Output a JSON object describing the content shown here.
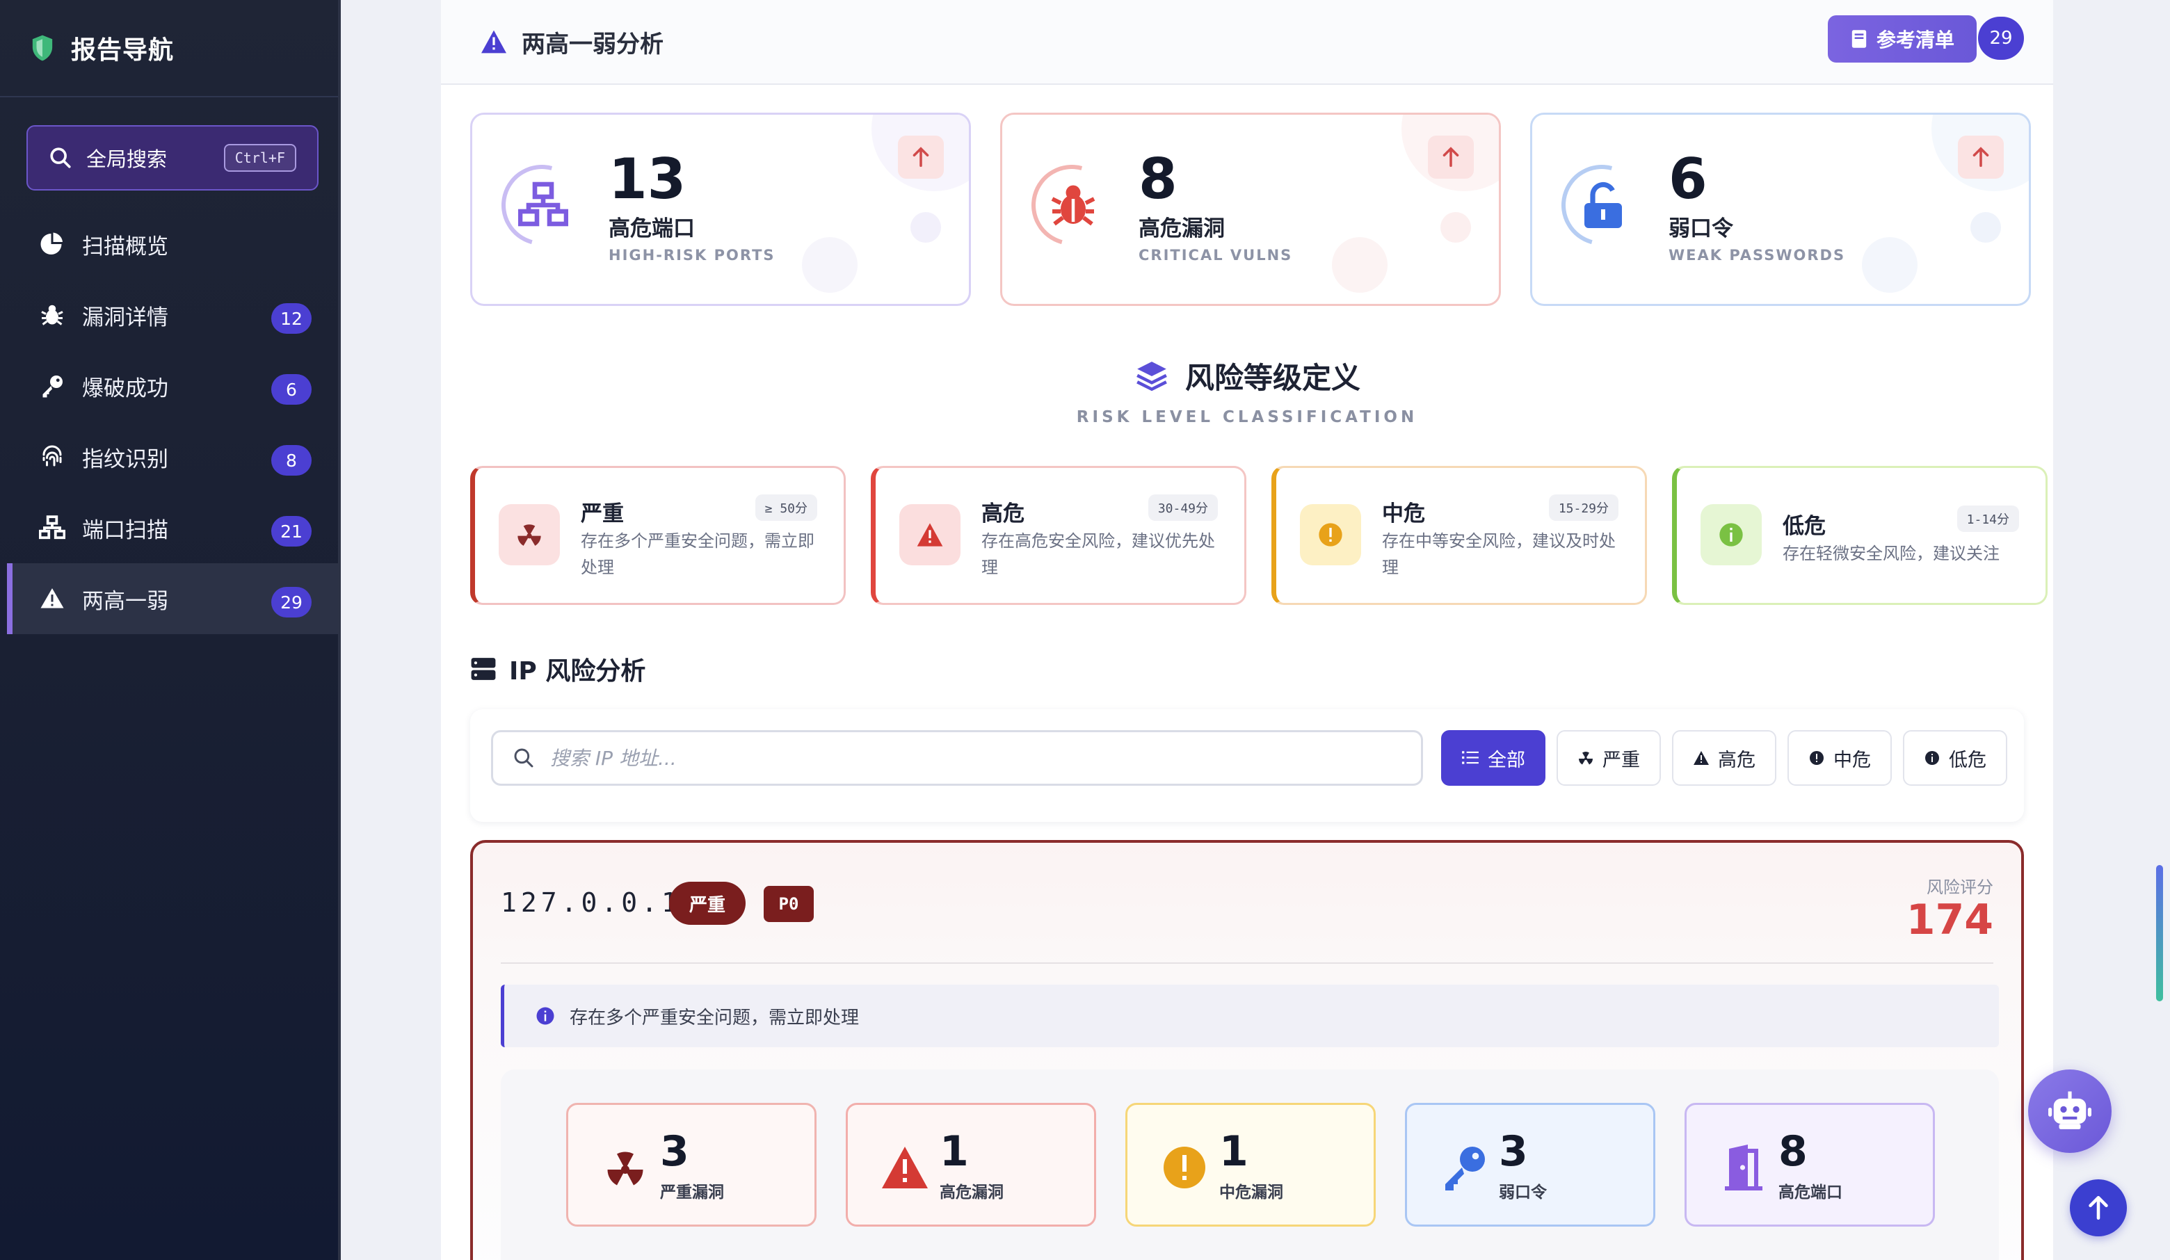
{
  "sidebar": {
    "title": "报告导航",
    "search": {
      "label": "全局搜索",
      "shortcut": "Ctrl+F"
    },
    "items": [
      {
        "label": "扫描概览",
        "icon": "pie-chart-icon",
        "badge": null
      },
      {
        "label": "漏洞详情",
        "icon": "bug-icon",
        "badge": "12"
      },
      {
        "label": "爆破成功",
        "icon": "key-icon",
        "badge": "6"
      },
      {
        "label": "指纹识别",
        "icon": "fingerprint-icon",
        "badge": "8"
      },
      {
        "label": "端口扫描",
        "icon": "network-icon",
        "badge": "21"
      },
      {
        "label": "两高一弱",
        "icon": "warning-icon",
        "badge": "29"
      }
    ],
    "active": "两高一弱"
  },
  "header": {
    "title": "两高一弱分析",
    "ref_button": "参考清单",
    "ref_count": "29"
  },
  "stats": [
    {
      "value": "13",
      "label": "高危端口",
      "sub": "HIGH-RISK PORTS",
      "icon": "network-icon",
      "color": "#7c5ce0"
    },
    {
      "value": "8",
      "label": "高危漏洞",
      "sub": "CRITICAL VULNS",
      "icon": "bug-icon",
      "color": "#e0463e"
    },
    {
      "value": "6",
      "label": "弱口令",
      "sub": "WEAK PASSWORDS",
      "icon": "unlock-icon",
      "color": "#3a6ee0"
    }
  ],
  "risk_section": {
    "title": "风险等级定义",
    "subtitle": "RISK LEVEL CLASSIFICATION",
    "levels": [
      {
        "name": "严重",
        "range": "≥ 50分",
        "desc": "存在多个严重安全问题，需立即处理",
        "icon": "radiation-icon",
        "color": "#c0392b"
      },
      {
        "name": "高危",
        "range": "30-49分",
        "desc": "存在高危安全风险，建议优先处理",
        "icon": "warning-icon",
        "color": "#e0463e"
      },
      {
        "name": "中危",
        "range": "15-29分",
        "desc": "存在中等安全风险，建议及时处理",
        "icon": "exclamation-icon",
        "color": "#e8a21a"
      },
      {
        "name": "低危",
        "range": "1-14分",
        "desc": "存在轻微安全风险，建议关注",
        "icon": "info-icon",
        "color": "#7ac143"
      }
    ]
  },
  "ip_section": {
    "title": "IP 风险分析",
    "search_placeholder": "搜索 IP 地址...",
    "filters": [
      "全部",
      "严重",
      "高危",
      "中危",
      "低危"
    ],
    "active_filter": "全部"
  },
  "ip_card": {
    "ip": "127.0.0.1",
    "severity": "严重",
    "priority": "P0",
    "score_label": "风险评分",
    "score": "174",
    "note": "存在多个严重安全问题，需立即处理",
    "metrics": [
      {
        "value": "3",
        "label": "严重漏洞",
        "icon": "radiation-icon"
      },
      {
        "value": "1",
        "label": "高危漏洞",
        "icon": "warning-icon"
      },
      {
        "value": "1",
        "label": "中危漏洞",
        "icon": "exclamation-icon"
      },
      {
        "value": "3",
        "label": "弱口令",
        "icon": "key-icon"
      },
      {
        "value": "8",
        "label": "高危端口",
        "icon": "door-icon"
      }
    ]
  }
}
